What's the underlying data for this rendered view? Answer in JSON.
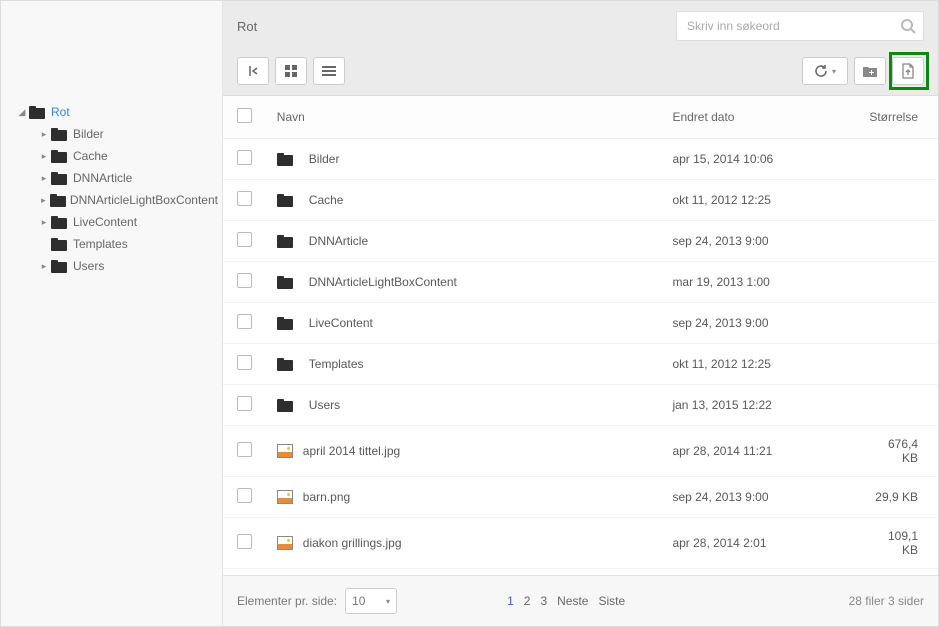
{
  "breadcrumb": "Rot",
  "search": {
    "placeholder": "Skriv inn søkeord"
  },
  "tree": {
    "root": {
      "label": "Rot"
    },
    "children": [
      {
        "label": "Bilder",
        "expandable": true
      },
      {
        "label": "Cache",
        "expandable": true
      },
      {
        "label": "DNNArticle",
        "expandable": true
      },
      {
        "label": "DNNArticleLightBoxContent",
        "expandable": true
      },
      {
        "label": "LiveContent",
        "expandable": true
      },
      {
        "label": "Templates",
        "expandable": false
      },
      {
        "label": "Users",
        "expandable": true
      }
    ]
  },
  "columns": {
    "name": "Navn",
    "date": "Endret dato",
    "size": "Størrelse"
  },
  "rows": [
    {
      "type": "folder",
      "name": "Bilder",
      "date": "apr 15, 2014 10:06",
      "size": ""
    },
    {
      "type": "folder",
      "name": "Cache",
      "date": "okt 11, 2012 12:25",
      "size": ""
    },
    {
      "type": "folder",
      "name": "DNNArticle",
      "date": "sep 24, 2013 9:00",
      "size": ""
    },
    {
      "type": "folder",
      "name": "DNNArticleLightBoxContent",
      "date": "mar 19, 2013 1:00",
      "size": ""
    },
    {
      "type": "folder",
      "name": "LiveContent",
      "date": "sep 24, 2013 9:00",
      "size": ""
    },
    {
      "type": "folder",
      "name": "Templates",
      "date": "okt 11, 2012 12:25",
      "size": ""
    },
    {
      "type": "folder",
      "name": "Users",
      "date": "jan 13, 2015 12:22",
      "size": ""
    },
    {
      "type": "image",
      "name": "april 2014 tittel.jpg",
      "date": "apr 28, 2014 11:21",
      "size": "676,4 KB"
    },
    {
      "type": "image",
      "name": "barn.png",
      "date": "sep 24, 2013 9:00",
      "size": "29,9 KB"
    },
    {
      "type": "image",
      "name": "diakon grillings.jpg",
      "date": "apr 28, 2014 2:01",
      "size": "109,1 KB"
    }
  ],
  "footer": {
    "per_page_label": "Elementer pr. side:",
    "per_page_value": "10",
    "pages": [
      "1",
      "2",
      "3"
    ],
    "next": "Neste",
    "last": "Siste",
    "info": "28 filer 3 sider"
  }
}
